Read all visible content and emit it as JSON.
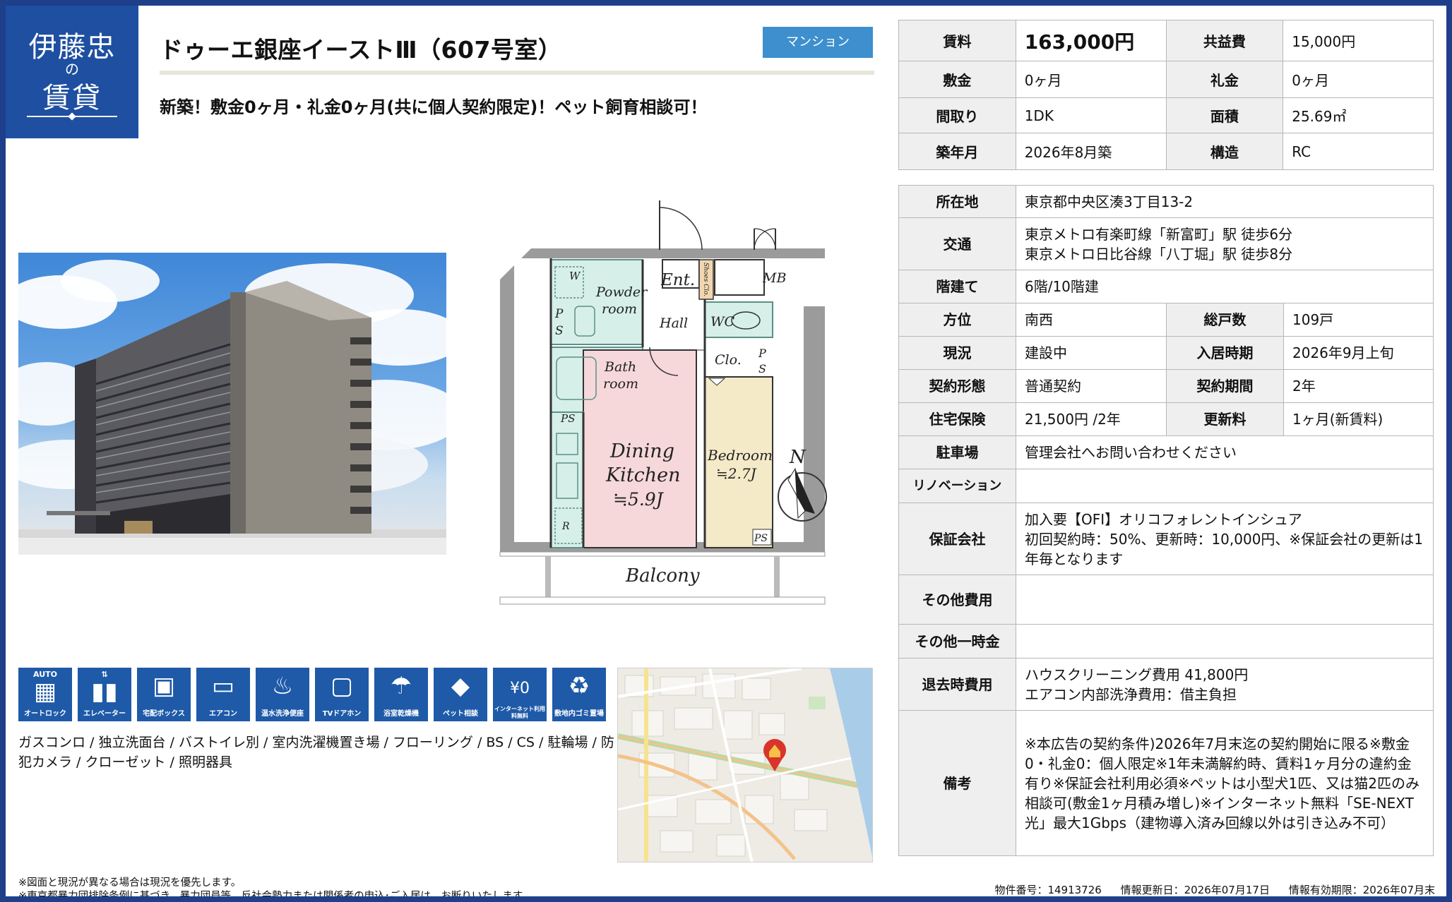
{
  "logo": {
    "line1": "伊藤忠",
    "line2": "の",
    "line3": "賃貸"
  },
  "property": {
    "title": "ドゥーエ銀座イーストⅢ（607号室）",
    "type": "マンション",
    "catch": "新築！敷金0ヶ月・礼金0ヶ月(共に個人契約限定)！ペット飼育相談可！"
  },
  "floorplan": {
    "labels": {
      "ent": "Ent.",
      "mb": "MB",
      "shoes": "Shoes Clo.",
      "w": "W",
      "powder": "Powder",
      "room": "room",
      "ps": "P",
      "ps2": "S",
      "ps_full": "PS",
      "hall": "Hall",
      "wc": "WC",
      "bath": "Bath",
      "clo": "Clo.",
      "dining": "Dining",
      "kitchen": "Kitchen",
      "dk_size": "≒5.9J",
      "bedroom": "Bedroom",
      "bed_size": "≒2.7J",
      "r": "R",
      "balcony": "Balcony",
      "north": "N"
    }
  },
  "amenities": [
    {
      "top": "AUTO",
      "glyph": "▦",
      "label": "オートロック",
      "icon": "keypad-icon"
    },
    {
      "top": "⇅",
      "glyph": "▮▮",
      "label": "エレベーター",
      "icon": "elevator-icon"
    },
    {
      "top": "",
      "glyph": "▣",
      "label": "宅配ボックス",
      "icon": "delivery-box-icon"
    },
    {
      "top": "",
      "glyph": "▭",
      "label": "エアコン",
      "icon": "air-conditioner-icon"
    },
    {
      "top": "",
      "glyph": "♨",
      "label": "温水洗浄便座",
      "icon": "washlet-icon"
    },
    {
      "top": "",
      "glyph": "▢",
      "label": "TVドアホン",
      "icon": "tv-intercom-icon"
    },
    {
      "top": "",
      "glyph": "☂",
      "label": "浴室乾燥機",
      "icon": "bath-dryer-icon"
    },
    {
      "top": "",
      "glyph": "◆",
      "label": "ペット相談",
      "icon": "pet-icon"
    },
    {
      "top": "",
      "glyph": "¥0",
      "label": "インターネット利用料無料",
      "icon": "wifi-icon"
    },
    {
      "top": "",
      "glyph": "♻",
      "label": "敷地内ゴミ置場",
      "icon": "garbage-icon"
    }
  ],
  "facilities": "ガスコンロ / 独立洗面台 / バストイレ別 / 室内洗濯機置き場 / フローリング / BS / CS / 駐輪場 / 防犯カメラ / クローゼット / 照明器具",
  "summary": {
    "rent_label": "賃料",
    "rent": "163,000円",
    "fee_label": "共益費",
    "fee": "15,000円",
    "deposit_label": "敷金",
    "deposit": "0ヶ月",
    "key_label": "礼金",
    "key": "0ヶ月",
    "layout_label": "間取り",
    "layout": "1DK",
    "area_label": "面積",
    "area": "25.69㎡",
    "built_label": "築年月",
    "built": "2026年8月築",
    "structure_label": "構造",
    "structure": "RC"
  },
  "details": {
    "address_label": "所在地",
    "address": "東京都中央区湊3丁目13-2",
    "access_label": "交通",
    "access1": "東京メトロ有楽町線「新富町」駅 徒歩6分",
    "access2": "東京メトロ日比谷線「八丁堀」駅 徒歩8分",
    "floor_label": "階建て",
    "floor": "6階/10階建",
    "direction_label": "方位",
    "direction": "南西",
    "units_label": "総戸数",
    "units": "109戸",
    "status_label": "現況",
    "status": "建設中",
    "movein_label": "入居時期",
    "movein": "2026年9月上旬",
    "contract_label": "契約形態",
    "contract": "普通契約",
    "term_label": "契約期間",
    "term": "2年",
    "insurance_label": "住宅保険",
    "insurance": "21,500円 /2年",
    "renewal_label": "更新料",
    "renewal": "1ヶ月(新賃料)",
    "parking_label": "駐車場",
    "parking": "管理会社へお問い合わせください",
    "renovation_label": "リノベーション",
    "renovation": "",
    "guarantor_label": "保証会社",
    "guarantor1": "加入要【OFI】オリコフォレントインシュア",
    "guarantor2": "初回契約時：50%、更新時：10,000円、※保証会社の更新は1年毎となります",
    "other_label": "その他費用",
    "other": "",
    "onetime_label": "その他一時金",
    "onetime": "",
    "moveout_label": "退去時費用",
    "moveout1": "ハウスクリーニング費用 41,800円",
    "moveout2": "エアコン内部洗浄費用：借主負担",
    "remarks_label": "備考",
    "remarks": "※本広告の契約条件)2026年7月末迄の契約開始に限る※敷金0・礼金0：個人限定※1年未満解約時、賃料1ヶ月分の違約金有り※保証会社利用必須※ペットは小型犬1匹、又は猫2匹のみ相談可(敷金1ヶ月積み増し)※インターネット無料「SE-NEXT光」最大1Gbps（建物導入済み回線以外は引き込み不可）"
  },
  "notes": {
    "n1": "※図面と現況が異なる場合は現況を優先します。",
    "n2": "※東京都暴力団排除条例に基づき、暴力団員等、反社会勢力または関係者の申込･ご入居は、お断りいたします。"
  },
  "footer": {
    "id": "物件番号：14913726",
    "updated": "情報更新日：2026年07月17日",
    "valid": "情報有効期限：2026年07月末"
  },
  "colors": {
    "brand": "#1e4fa0",
    "badge": "#3d8fce",
    "icon_bg": "#1e5aa8",
    "header_cell": "#efefef"
  }
}
